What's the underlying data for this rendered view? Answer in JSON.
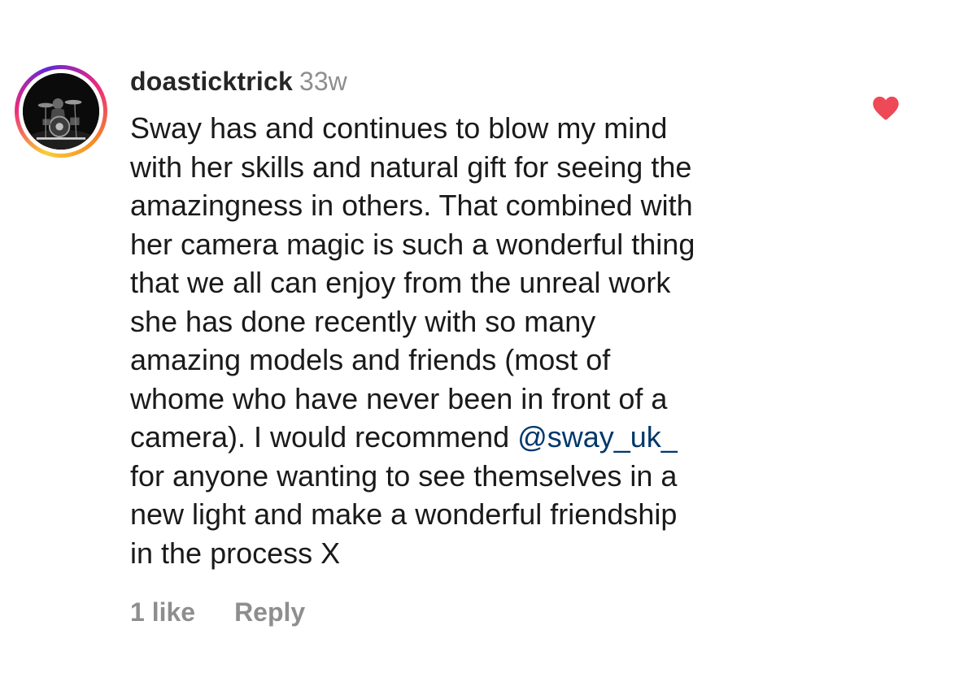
{
  "comment": {
    "username": "doasticktrick",
    "timestamp": "33w",
    "lines": [
      "Sway has and continues to blow my mind",
      "with her skills and natural gift for seeing the",
      "amazingness in others. That combined with",
      "her camera magic is such a wonderful thing",
      "that we all can enjoy from the unreal work",
      "she has done recently with so many",
      "amazing models and friends (most of",
      "whome who have never been in front of a"
    ],
    "mention_line": {
      "before": "camera). I would recommend ",
      "mention": "@sway_uk_"
    },
    "lines_after": [
      "for anyone wanting to see themselves in a",
      "new light and make a wonderful friendship",
      "in the process X"
    ],
    "likes_label": "1 like",
    "reply_label": "Reply",
    "liked": true
  },
  "icons": {
    "avatar": "profile-avatar",
    "heart": "heart-icon"
  },
  "colors": {
    "heart": "#ed4956",
    "mention": "#00376b",
    "secondary_text": "#8e8e8e"
  }
}
